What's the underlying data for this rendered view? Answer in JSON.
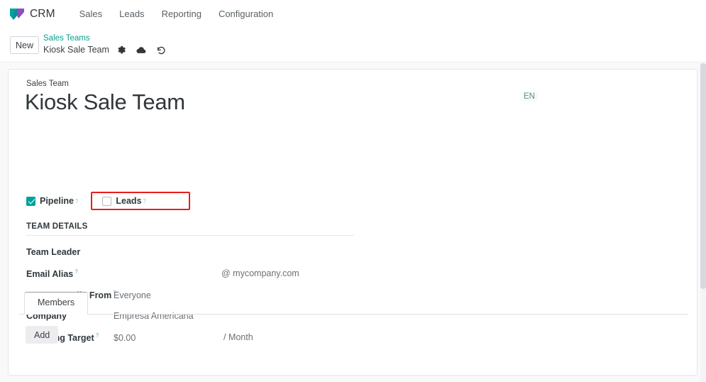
{
  "navbar": {
    "logo_icon": "odoo-crm-logo-icon",
    "brand": "CRM",
    "menu": [
      {
        "label": "Sales"
      },
      {
        "label": "Leads"
      },
      {
        "label": "Reporting"
      },
      {
        "label": "Configuration"
      }
    ]
  },
  "control_panel": {
    "new_button": "New",
    "breadcrumb_parent": "Sales Teams",
    "breadcrumb_current": "Kiosk Sale Team",
    "gear_icon": "gear-icon",
    "save_icon": "cloud-save-icon",
    "discard_icon": "undo-discard-icon"
  },
  "form": {
    "model_label": "Sales Team",
    "title": "Kiosk Sale Team",
    "language_badge": "EN",
    "checkboxes": [
      {
        "label": "Pipeline",
        "checked": true,
        "tooltip": "?",
        "highlighted": false
      },
      {
        "label": "Leads",
        "checked": false,
        "tooltip": "?",
        "highlighted": true
      }
    ],
    "section_title": "TEAM DETAILS",
    "fields": [
      {
        "label": "Team Leader",
        "tooltip": "",
        "value": "",
        "suffix": ""
      },
      {
        "label": "Email Alias",
        "tooltip": "?",
        "value": "",
        "suffix": "@ mycompany.com"
      },
      {
        "label": "Accept Emails From",
        "tooltip": "?",
        "value": "Everyone",
        "suffix": ""
      },
      {
        "label": "Company",
        "tooltip": "",
        "value": "Empresa Americana",
        "suffix": ""
      },
      {
        "label": "Invoicing Target",
        "tooltip": "?",
        "value": "$0.00",
        "suffix": "/ Month"
      }
    ],
    "tabs": [
      {
        "label": "Members",
        "active": true
      }
    ],
    "add_button": "Add"
  },
  "colors": {
    "accent_teal": "#00a09d",
    "link_teal": "#04a28e",
    "highlight_red": "#e81d1d",
    "text_dark": "#31373b",
    "text_muted": "#6b7074"
  }
}
